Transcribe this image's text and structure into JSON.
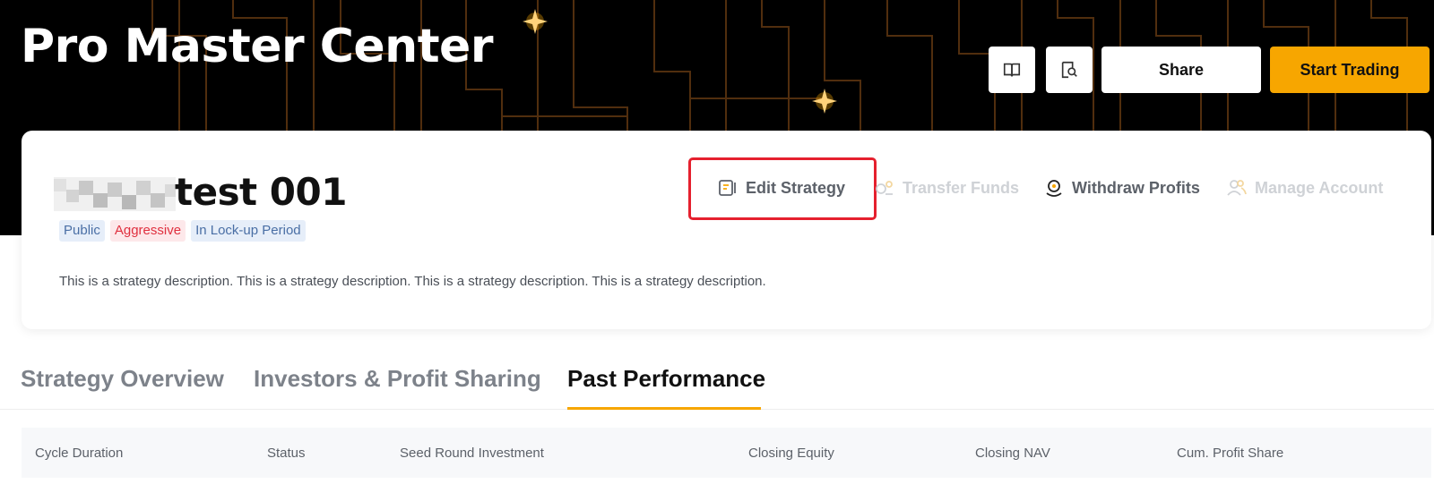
{
  "header": {
    "title": "Pro Master Center",
    "guide_icon": "book-icon",
    "search_icon": "search-document-icon",
    "share_label": "Share",
    "start_trading_label": "Start Trading"
  },
  "strategy": {
    "name": "test 001",
    "tags": [
      "Public",
      "Aggressive",
      "In Lock-up Period"
    ],
    "description": "This is a strategy description. This is a strategy description. This is a strategy description. This is a strategy description."
  },
  "actions": {
    "edit_label": "Edit Strategy",
    "transfer_label": "Transfer Funds",
    "withdraw_label": "Withdraw Profits",
    "manage_label": "Manage Account"
  },
  "tabs": [
    "Strategy Overview",
    "Investors & Profit Sharing",
    "Past Performance"
  ],
  "active_tab": "Past Performance",
  "table": {
    "columns": [
      "Cycle Duration",
      "Status",
      "Seed Round Investment",
      "Closing Equity",
      "Closing NAV",
      "Cum. Profit Share"
    ]
  },
  "colors": {
    "accent": "#F7A600",
    "highlight_border": "#E5202E",
    "tag_public_bg": "#E6EEF9",
    "tag_aggressive_text": "#E0303F"
  }
}
